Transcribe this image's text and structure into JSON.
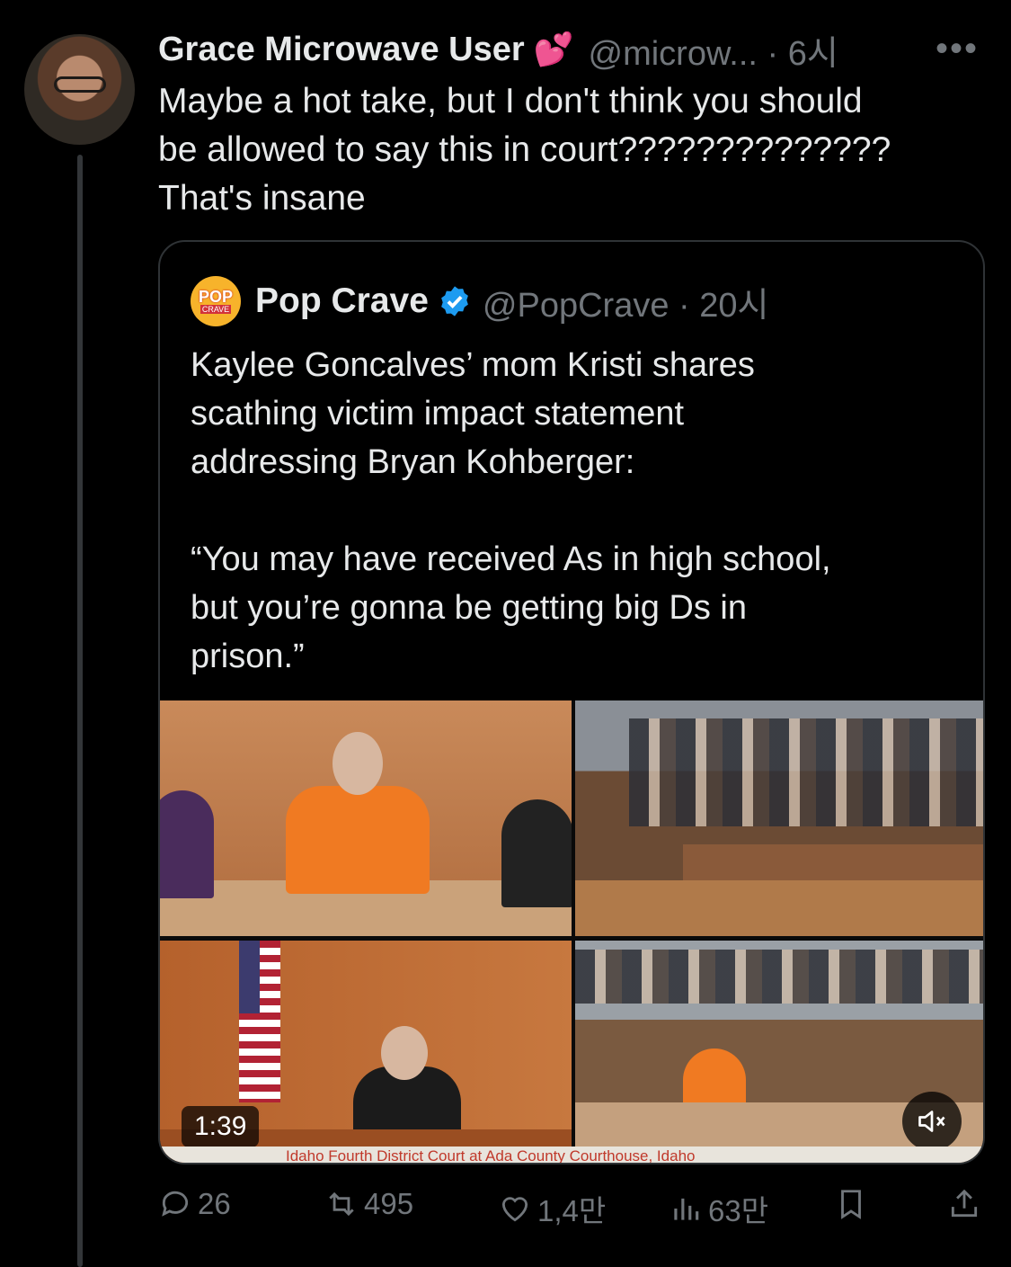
{
  "tweet": {
    "author_name": "Grace Microwave User",
    "author_emoji": "💕",
    "handle_time": "@microw... · 6시",
    "more_label": "•••",
    "text_lines": [
      "Maybe a hot take, but I don't think you should",
      "be allowed to say this in court??????????????",
      "That's insane"
    ]
  },
  "quote": {
    "logo_top": "POP",
    "logo_bottom": "CRAVE",
    "author_name": "Pop Crave",
    "handle_time": "@PopCrave · 20시",
    "text_lines": [
      "Kaylee Goncalves’ mom Kristi shares",
      "scathing victim impact statement",
      "addressing Bryan Kohberger:",
      "",
      "“You may have received As in high school,",
      "but you’re gonna be getting big Ds in",
      "prison.”"
    ],
    "video": {
      "duration": "1:39",
      "ticker": "Idaho Fourth District Court at Ada County Courthouse, Idaho",
      "mute_icon": "speaker-muted-icon"
    }
  },
  "actions": {
    "replies": "26",
    "reposts": "495",
    "likes": "1,4만",
    "views": "63만"
  },
  "colors": {
    "background": "#000000",
    "text_primary": "#e7e9ea",
    "text_secondary": "#71767b",
    "border": "#2f3336",
    "verified": "#1d9bf0"
  }
}
